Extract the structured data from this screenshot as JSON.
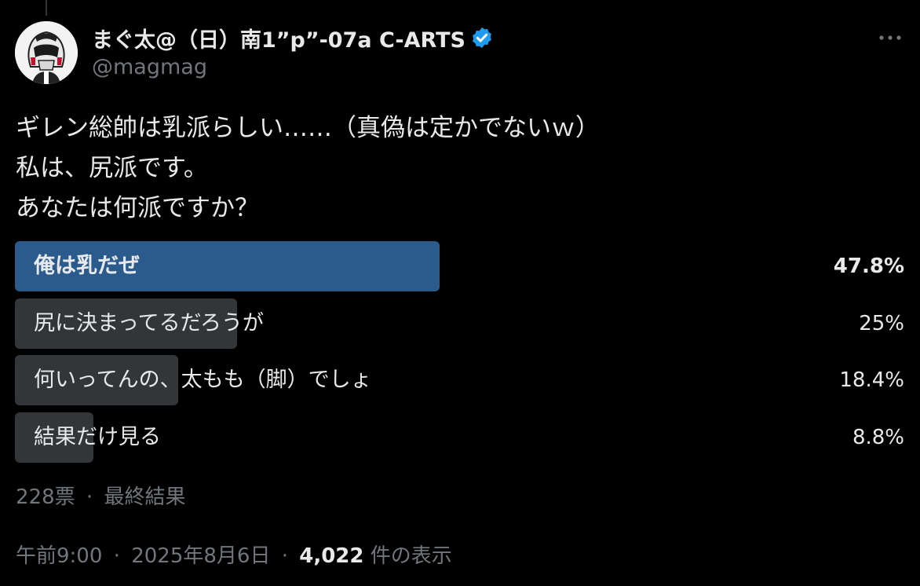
{
  "author": {
    "display_name": "まぐ太@（日）南1”p”-07a C-ARTS",
    "handle": "@magmag",
    "verified": true,
    "avatar_icon": "helmet-avatar-icon"
  },
  "tweet": {
    "lines": [
      "ギレン総帥は乳派らしい……（真偽は定かでないｗ）",
      "私は、尻派です。",
      "あなたは何派ですか？"
    ]
  },
  "poll": {
    "options": [
      {
        "label": "俺は乳だぜ",
        "percent_text": "47.8%",
        "percent": 47.8,
        "winner": true
      },
      {
        "label": "尻に決まってるだろうが",
        "percent_text": "25%",
        "percent": 25,
        "winner": false
      },
      {
        "label": "何いってんの、太もも（脚）でしょ",
        "percent_text": "18.4%",
        "percent": 18.4,
        "winner": false
      },
      {
        "label": "結果だけ見る",
        "percent_text": "8.8%",
        "percent": 8.8,
        "winner": false
      }
    ],
    "votes": "228票",
    "separator": "·",
    "status": "最終結果"
  },
  "meta": {
    "time": "午前9:00",
    "date": "2025年8月6日",
    "views_count": "4,022",
    "views_label": "件の表示",
    "separator": "·"
  },
  "colors": {
    "background": "#000000",
    "text_primary": "#e7e9ea",
    "text_secondary": "#71767b",
    "poll_winner_bar": "#2b5a8d",
    "poll_bar": "#333639",
    "verified_badge": "#1d9bf0"
  },
  "icons": {
    "more": "more-horizontal-icon",
    "verified": "verified-badge-icon"
  }
}
